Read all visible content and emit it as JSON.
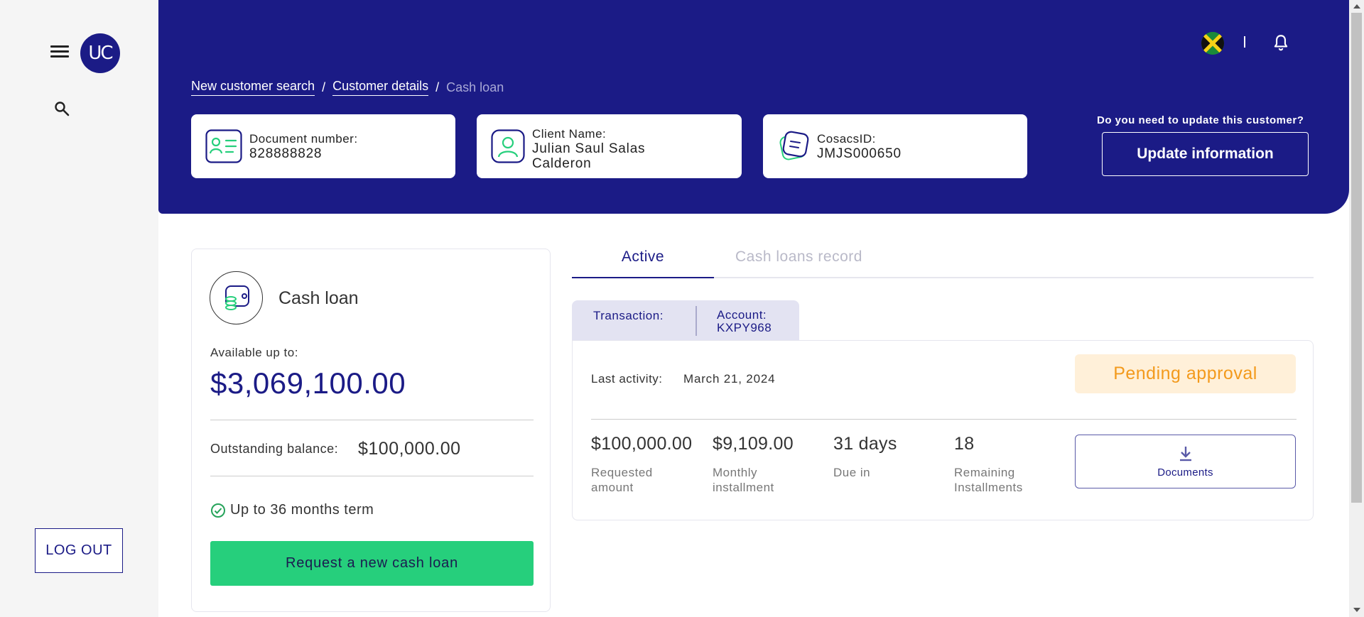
{
  "sidebar": {
    "avatar_initials": "UC",
    "logout_label": "LOG OUT"
  },
  "header": {
    "breadcrumb": {
      "item1": "New customer search",
      "item2": "Customer details",
      "current": "Cash loan",
      "separator": "/"
    },
    "cards": {
      "document": {
        "label": "Document number:",
        "value": "828888828"
      },
      "client": {
        "label": "Client Name:",
        "value_line1": "Julian Saul Salas",
        "value_line2": "Calderon"
      },
      "cosacs": {
        "label": "CosacsID:",
        "value": "JMJS000650"
      }
    },
    "update_question": "Do you need to update this customer?",
    "update_button": "Update information",
    "divider": "|"
  },
  "loan_card": {
    "title": "Cash loan",
    "available_label": "Available up to:",
    "available_value": "$3,069,100.00",
    "outstanding_label": "Outstanding balance:",
    "outstanding_value": "$100,000.00",
    "term_text": "Up to 36 months term",
    "request_button": "Request a new cash loan"
  },
  "tabs": {
    "active": "Active",
    "record": "Cash loans record"
  },
  "subtabs": {
    "transaction_label": "Transaction:",
    "account_label": "Account:",
    "account_value": "KXPY968"
  },
  "transaction": {
    "last_activity_label": "Last activity:",
    "last_activity_value": "March 21, 2024",
    "status": "Pending approval",
    "stats": [
      {
        "value": "$100,000.00",
        "label_line1": "Requested",
        "label_line2": "amount"
      },
      {
        "value": "$9,109.00",
        "label_line1": "Monthly",
        "label_line2": "installment"
      },
      {
        "value": "31 days",
        "label_line1": "Due in",
        "label_line2": ""
      },
      {
        "value": "18",
        "label_line1": "Remaining",
        "label_line2": "Installments"
      }
    ],
    "documents_button": "Documents"
  },
  "colors": {
    "brand_navy": "#1b1b86",
    "accent_green": "#26cf7c",
    "pending_bg": "#fff0d9",
    "pending_text": "#f39a1c"
  },
  "icons": [
    "menu-icon",
    "search-icon",
    "flag-icon",
    "bell-icon",
    "id-card-icon",
    "user-icon",
    "document-icon",
    "cash-loan-icon",
    "check-circle-icon",
    "download-icon"
  ]
}
